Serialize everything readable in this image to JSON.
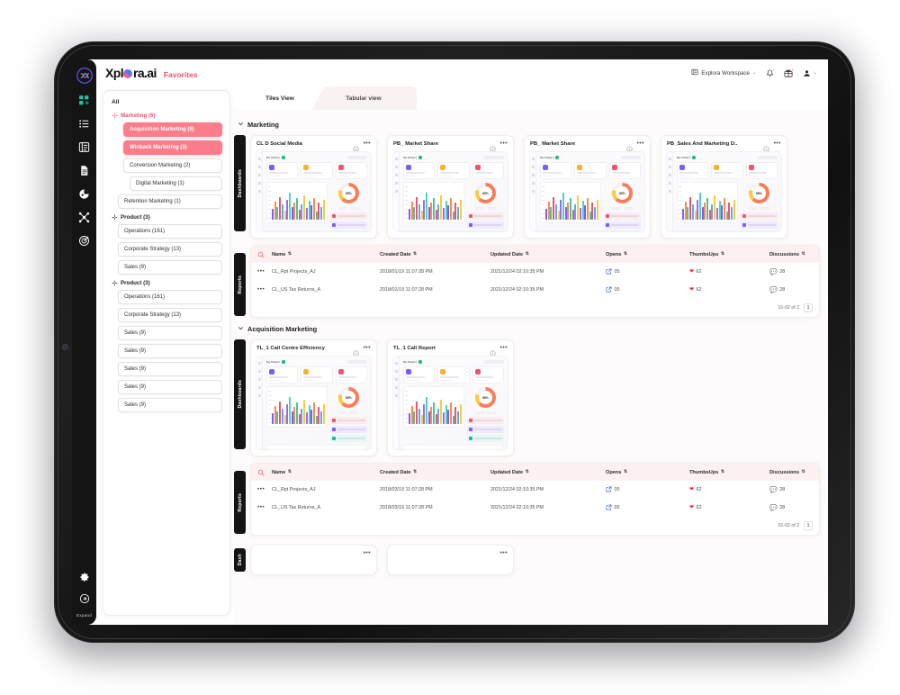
{
  "brand": {
    "name_left": "Xpl",
    "name_right": "ra.ai",
    "favorites": "Favorites"
  },
  "topbar": {
    "workspace": "Explora Workspace",
    "workspace_icon": "workspace-icon",
    "bell_icon": "bell-icon",
    "gift_icon": "gift-card-icon",
    "avatar_icon": "user-avatar-icon",
    "chevron": "⌄"
  },
  "rail": {
    "logo_icon": "explora-logo-icon",
    "items": [
      {
        "name": "dashboards-icon",
        "active": true
      },
      {
        "name": "list-icon",
        "active": false
      },
      {
        "name": "tree-list-icon",
        "active": false
      },
      {
        "name": "document-icon",
        "active": false
      },
      {
        "name": "pie-chart-icon",
        "active": false
      },
      {
        "name": "network-icon",
        "active": false
      },
      {
        "name": "target-icon",
        "active": false
      }
    ],
    "settings_icon": "gear-icon",
    "logout_icon": "logout-icon",
    "expand_label": "Expand"
  },
  "filters": {
    "all_label": "All",
    "groups": [
      {
        "label": "Marketing (6)",
        "tone": "pink",
        "chips": [
          {
            "label": "Acquisition Marketing (6)",
            "indent": "lvl1",
            "selected": true
          },
          {
            "label": "Winback Marketing (3)",
            "indent": "lvl1",
            "selected": true
          },
          {
            "label": "Conversion Marketing (2)",
            "indent": "lvl1",
            "selected": false
          },
          {
            "label": "Digital Marketing (1)",
            "indent": "lvl2",
            "selected": false
          },
          {
            "label": "Retention Marketing (1)",
            "indent": "lvl0",
            "selected": false
          }
        ]
      },
      {
        "label": "Product (3)",
        "tone": "dark",
        "chips": [
          {
            "label": "Operations (161)",
            "indent": "lvl0",
            "selected": false
          },
          {
            "label": "Corporate Strategy (13)",
            "indent": "lvl0",
            "selected": false
          },
          {
            "label": "Sales (9)",
            "indent": "lvl0",
            "selected": false
          }
        ]
      },
      {
        "label": "Product (3)",
        "tone": "dark",
        "chips": [
          {
            "label": "Operations (161)",
            "indent": "lvl0",
            "selected": false
          },
          {
            "label": "Corporate Strategy (13)",
            "indent": "lvl0",
            "selected": false
          },
          {
            "label": "Sales (9)",
            "indent": "lvl0",
            "selected": false
          },
          {
            "label": "Sales (9)",
            "indent": "lvl0",
            "selected": false
          },
          {
            "label": "Sales (9)",
            "indent": "lvl0",
            "selected": false
          },
          {
            "label": "Sales (9)",
            "indent": "lvl0",
            "selected": false
          },
          {
            "label": "Sales (9)",
            "indent": "lvl0",
            "selected": false
          }
        ]
      }
    ]
  },
  "tabs": {
    "active": "Tiles View",
    "inactive": "Tabular view"
  },
  "table_columns": [
    {
      "key": "name",
      "label": "Name"
    },
    {
      "key": "created",
      "label": "Created Date"
    },
    {
      "key": "updated",
      "label": "Updated Date"
    },
    {
      "key": "opens",
      "label": "Opens"
    },
    {
      "key": "thumbs",
      "label": "ThumbsUps"
    },
    {
      "key": "disc",
      "label": "Discussions"
    }
  ],
  "sections": [
    {
      "title": "Marketing",
      "dashboards_tab": "Dashboards",
      "reports_tab": "Reports",
      "cards": [
        {
          "title": "CL D Social Media",
          "percent": "85%"
        },
        {
          "title": "PB_ Market Share",
          "percent": "85%"
        },
        {
          "title": "PB_ Market Share",
          "percent": "85%"
        },
        {
          "title": "PB_Sales And Marketing D..",
          "percent": "85%"
        }
      ],
      "rows": [
        {
          "name": "CL_Rpt Projects_AJ",
          "created": "2018/01/19 11:07:28 PM",
          "updated": "2021/12/24 02:10:35 PM",
          "opens": "05",
          "thumbs": "62",
          "disc": "28"
        },
        {
          "name": "CL_US Tax Returns_A",
          "created": "2018/01/19 11:07:28 PM",
          "updated": "2021/12/24 02:10:35 PM",
          "opens": "05",
          "thumbs": "62",
          "disc": "28"
        }
      ],
      "pager": {
        "range": "01-02 of 2",
        "page": "1"
      }
    },
    {
      "title": "Acquisition Marketing",
      "dashboards_tab": "Dashboards",
      "reports_tab": "Reports",
      "cards": [
        {
          "title": "TL_1 Call Centre Efficiency",
          "percent": "85%"
        },
        {
          "title": "TL_1 Call Report",
          "percent": "85%"
        }
      ],
      "rows": [
        {
          "name": "CL_Rpt Projects_AJ",
          "created": "2018/03/19 11:07:28 PM",
          "updated": "2021/12/24 02:10:35 PM",
          "opens": "05",
          "thumbs": "62",
          "disc": "28"
        },
        {
          "name": "CL_US Tax Returns_A",
          "created": "2018/03/19 11:07:28 PM",
          "updated": "2021/12/24 02:10:35 PM",
          "opens": "05",
          "thumbs": "62",
          "disc": "28"
        }
      ],
      "pager": {
        "range": "01-02 of 2",
        "page": "1"
      }
    },
    {
      "title": "",
      "dashboards_tab": "Dash",
      "reports_tab": "",
      "cards": [],
      "rows": [],
      "pager": {
        "range": "",
        "page": ""
      }
    }
  ],
  "colors": {
    "accent_pink": "#fb7d8b",
    "brand_pink": "#f2536c",
    "table_header_bg": "#fcf1f0",
    "rail_bg": "#141414",
    "heart_red": "#ef2b43",
    "bubble_green": "#7cb342",
    "open_blue": "#3b5bdb",
    "active_teal": "#23c0a3"
  },
  "icons": {
    "chevron_down": "⌄",
    "sort": "⇅",
    "info": "i",
    "more": "•••",
    "search": "search-icon"
  }
}
